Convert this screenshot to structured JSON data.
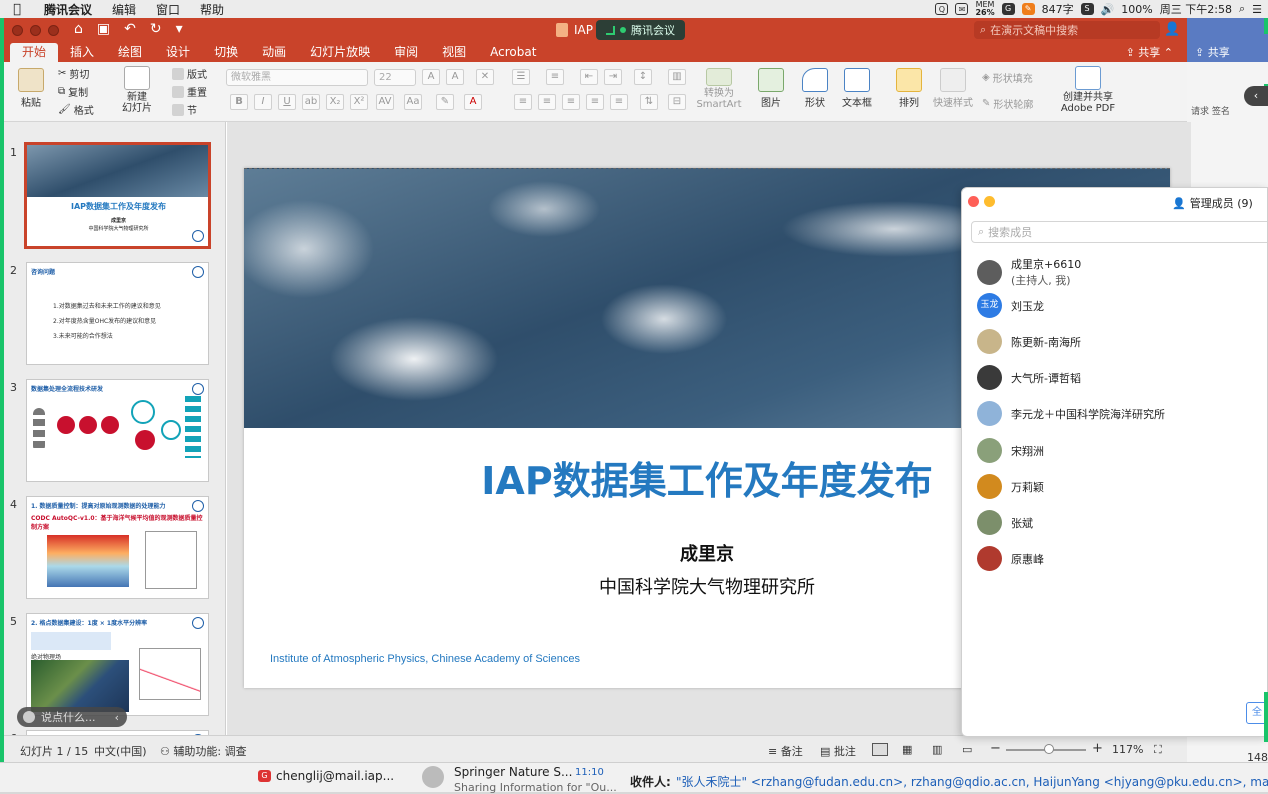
{
  "menubar": {
    "app": "腾讯会议",
    "items": [
      "编辑",
      "窗口",
      "帮助"
    ],
    "status": {
      "mem_label": "MEM",
      "mem_value": "26%",
      "word_count": "847字",
      "battery": "100%",
      "clock": "周三 下午2:58"
    }
  },
  "window": {
    "title": "IAP",
    "meeting_pill": "腾讯会议",
    "search_placeholder": "在演示文稿中搜索",
    "share_label": "共享",
    "tabs": [
      "开始",
      "插入",
      "绘图",
      "设计",
      "切换",
      "动画",
      "幻灯片放映",
      "审阅",
      "视图",
      "Acrobat"
    ],
    "active_tab": "开始"
  },
  "ribbon": {
    "paste": "粘贴",
    "cut": "剪切",
    "copy": "复制",
    "format": "格式",
    "new_slide": "新建\n幻灯片",
    "layout": "版式",
    "reset": "重置",
    "section": "节",
    "font_name": "微软雅黑",
    "font_size": "22",
    "convert_smartart": "转换为\nSmartArt",
    "picture": "图片",
    "shape": "形状",
    "textbox": "文本框",
    "arrange": "排列",
    "quick_styles": "快速样式",
    "shape_fill": "形状填充",
    "shape_outline": "形状轮廓",
    "create_share_pdf": "创建并共享\nAdobe PDF",
    "request_sign": "请求\n签名"
  },
  "thumbnails": [
    {
      "num": "1",
      "title": "IAP数据集工作及年度发布",
      "sub": "成里京",
      "sub2": "中国科学院大气物理研究所"
    },
    {
      "num": "2",
      "title": "咨询问题",
      "lines": [
        "1.对数据集过去和未来工作的建议和意见",
        "2.对年度热含量OHC发布的建议和意见",
        "3.未来可能的合作想法"
      ]
    },
    {
      "num": "3",
      "title": "数据集处理全流程技术研发"
    },
    {
      "num": "4",
      "title": "1. 数据质量控制：提高对原始观测数据的处理能力",
      "sub": "CODC AutoQC-v1.0：基于海洋气候平均值的观测数据质量控制方案"
    },
    {
      "num": "5",
      "title": "2. 格点数据集建设：1度 × 1度水平分辨率",
      "sub": "绝对物理场"
    },
    {
      "num": "6",
      "title": ""
    }
  ],
  "slide": {
    "title": "IAP数据集工作及年度发布",
    "author": "成里京",
    "institution": "中国科学院大气物理研究所",
    "footer": "Institute of Atmospheric Physics, Chinese Academy of Sciences"
  },
  "statusbar": {
    "slide_info": "幻灯片 1 / 15",
    "language": "中文(中国)",
    "accessibility": "辅助功能: 调查",
    "notes": "备注",
    "comments": "批注",
    "zoom": "117%",
    "zoom_bg": "148%"
  },
  "chat_float": {
    "placeholder": "说点什么..."
  },
  "members_panel": {
    "title": "管理成员 (9)",
    "search_placeholder": "搜索成员",
    "members": [
      {
        "name": "成里京+6610",
        "sub": "(主持人, 我)",
        "color": "#5d5d5d",
        "initials": ""
      },
      {
        "name": "刘玉龙",
        "sub": "",
        "color": "#2d7be4",
        "initials": "玉龙"
      },
      {
        "name": "陈更新-南海所",
        "sub": "",
        "color": "#c8b58a",
        "initials": ""
      },
      {
        "name": "大气所-谭哲韬",
        "sub": "",
        "color": "#3a3a3a",
        "initials": ""
      },
      {
        "name": "李元龙＋中国科学院海洋研究所",
        "sub": "",
        "color": "#8fb3d9",
        "initials": ""
      },
      {
        "name": "宋翔洲",
        "sub": "",
        "color": "#8aa07a",
        "initials": ""
      },
      {
        "name": "万莉颖",
        "sub": "",
        "color": "#d28a1e",
        "initials": ""
      },
      {
        "name": "张斌",
        "sub": "",
        "color": "#7c8f6b",
        "initials": ""
      },
      {
        "name": "原惠峰",
        "sub": "",
        "color": "#b03a2e",
        "initials": ""
      }
    ],
    "corner_button": "全"
  },
  "mailstrip": {
    "account": "chenglij@mail.iap...",
    "sender": "Springer Nature S...",
    "time": "11:10",
    "preview": "Sharing Information for \"Ou...",
    "to_label": "收件人:",
    "recipients": "\"张人禾院士\" <rzhang@fudan.edu.cn>, rzhang@qdio.ac.cn, HaijunYang <hjyang@pku.edu.cn>, mac-"
  },
  "colors": {
    "accent": "#c9432a",
    "title_blue": "#2479c0",
    "share_green": "#19c46a"
  }
}
